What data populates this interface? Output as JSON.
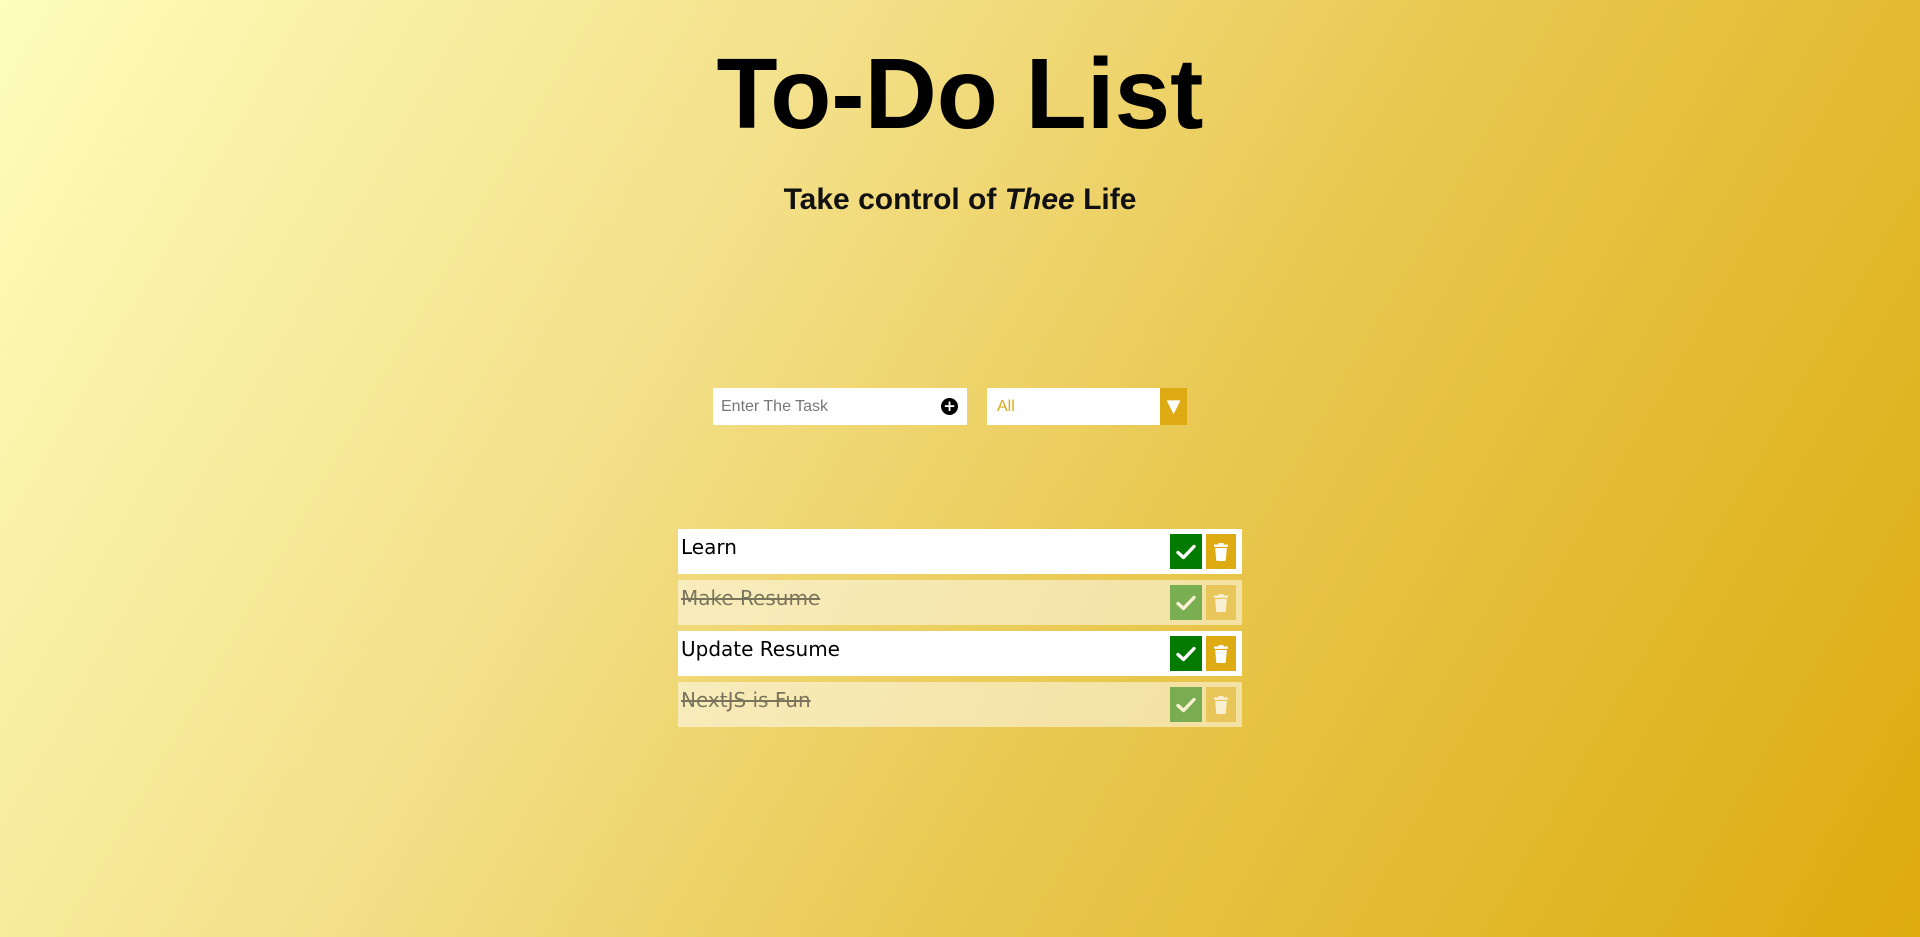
{
  "header": {
    "title": "To-Do List",
    "subtitle_prefix": "Take control of ",
    "subtitle_emphasis": "Thee",
    "subtitle_suffix": " Life"
  },
  "task_input": {
    "placeholder": "Enter The Task",
    "value": "",
    "add_icon": "plus-circle-icon"
  },
  "filter": {
    "selected": "All",
    "arrow_icon": "triangle-down-icon"
  },
  "todos": [
    {
      "text": "Learn",
      "completed": false
    },
    {
      "text": "Make Resume",
      "completed": true
    },
    {
      "text": "Update Resume",
      "completed": false
    },
    {
      "text": "NextJS is Fun",
      "completed": true
    }
  ],
  "icons": {
    "complete": "check-icon",
    "delete": "trash-icon"
  },
  "colors": {
    "complete_button": "#037a00",
    "trash_button": "#deab12",
    "filter_accent": "#ddaa14",
    "background_start": "#fefdbb",
    "background_end": "#ddab0e"
  }
}
